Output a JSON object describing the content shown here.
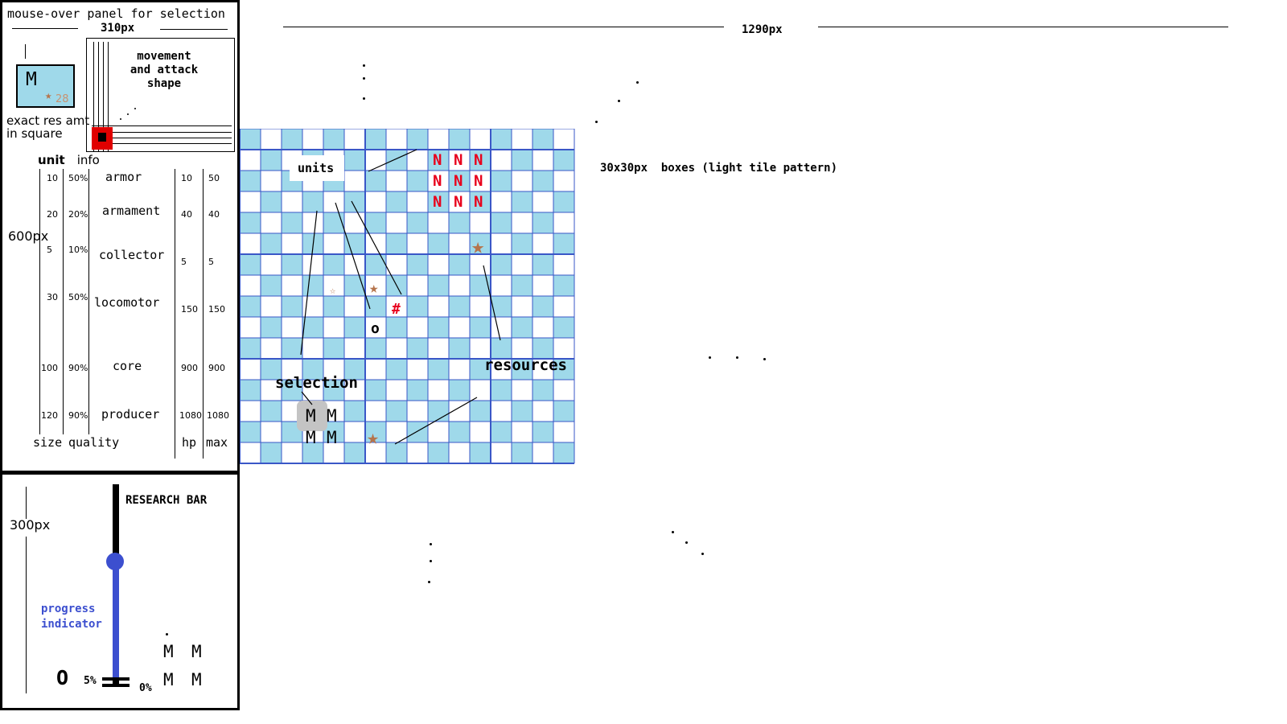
{
  "top_panel": {
    "title": "mouse-over panel for selection",
    "width_label": "310px",
    "height_label": "600px",
    "selected_unit_letter": "M",
    "resource_amount": "28",
    "exact_res_label_line1": "exact res amt",
    "exact_res_label_line2": "in square",
    "shape_label_line1": "movement",
    "shape_label_line2": "and attack",
    "shape_label_line3": "shape",
    "unit_info_bold": "unit",
    "unit_info_rest": "info",
    "rows": [
      {
        "size": "10",
        "quality": "50%",
        "name": "armor",
        "hp": "10",
        "max": "50"
      },
      {
        "size": "20",
        "quality": "20%",
        "name": "armament",
        "hp": "40",
        "max": "40"
      },
      {
        "size": "5",
        "quality": "10%",
        "name": "collector",
        "hp": "5",
        "max": "5"
      },
      {
        "size": "30",
        "quality": "50%",
        "name": "locomotor",
        "hp": "150",
        "max": "150"
      },
      {
        "size": "100",
        "quality": "90%",
        "name": "core",
        "hp": "900",
        "max": "900"
      },
      {
        "size": "120",
        "quality": "90%",
        "name": "producer",
        "hp": "1080",
        "max": "1080"
      }
    ],
    "footer": {
      "size": "size",
      "quality": "quality",
      "hp": "hp",
      "max": "max"
    }
  },
  "research_panel": {
    "height_label": "300px",
    "title": "RESEARCH BAR",
    "progress_label_line1": "progress",
    "progress_label_line2": "indicator",
    "progress_percent": "5%",
    "zero_percent": "0%",
    "progress_value": 0.05,
    "glyph_o": "O",
    "m_glyphs": [
      "M",
      "M",
      "M",
      "M"
    ]
  },
  "map": {
    "width_label": "1290px",
    "tile_note": "30x30px  boxes (light tile pattern)",
    "label_units": "units",
    "label_selection": "selection",
    "label_resources": "resources",
    "enemy_unit_letter": "N",
    "own_unit_letter": "M",
    "structure_hash": "#",
    "structure_o": "o",
    "colors": {
      "tile": "#9fd9ea",
      "grid_line": "#3a57c7",
      "enemy": "#e8001c",
      "resource_star": "#b5744c",
      "progress": "#3c4fcf"
    }
  }
}
